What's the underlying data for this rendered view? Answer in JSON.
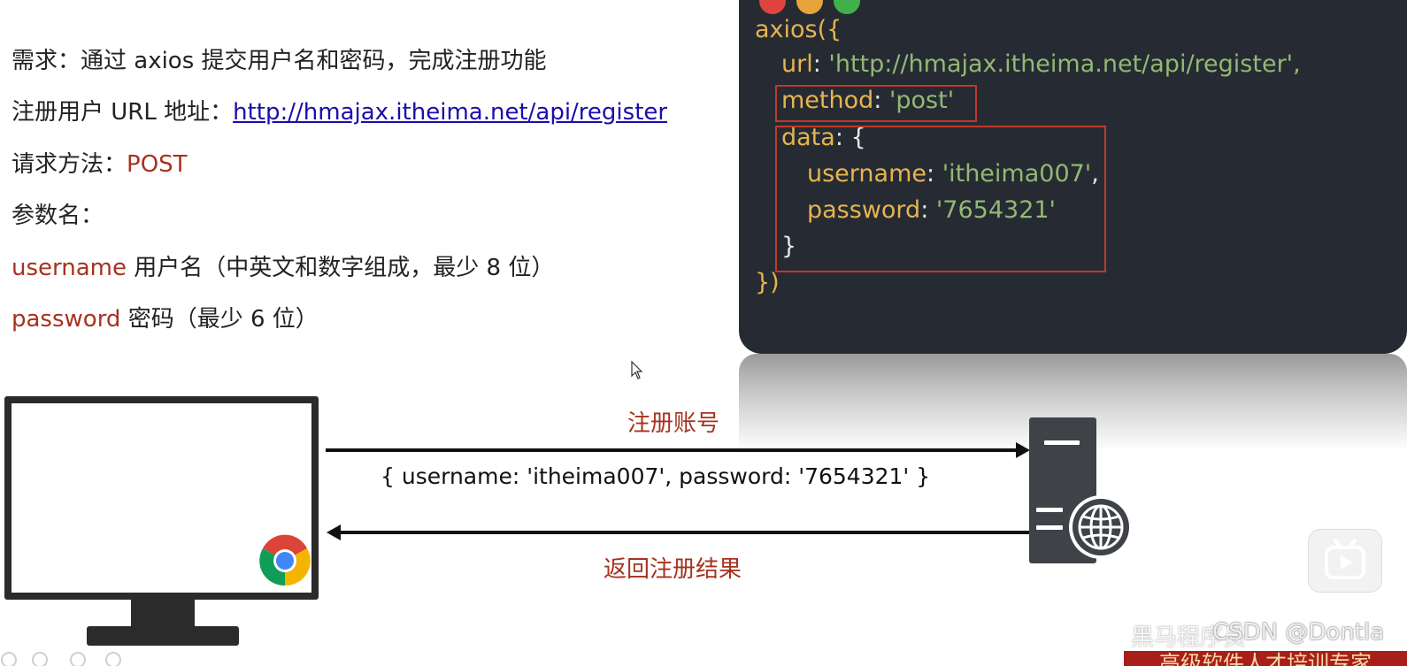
{
  "requirements": {
    "line1": "需求：通过 axios 提交用户名和密码，完成注册功能",
    "line2_prefix": "注册用户 URL 地址：",
    "line2_link": "http://hmajax.itheima.net/api/register",
    "line3_prefix": "请求方法：",
    "line3_method": "POST",
    "line4": "参数名：",
    "line5_param": "username",
    "line5_desc": " 用户名（中英文和数字组成，最少 8 位）",
    "line6_param": "password",
    "line6_desc": " 密码（最少 6 位）"
  },
  "code": {
    "line1": "axios({",
    "url_key": "url",
    "url_value": "'http://hmajax.itheima.net/api/register',",
    "method_key": "method",
    "method_value": "'post'",
    "data_key": "data",
    "data_open": ": {",
    "username_key": "username",
    "username_value": "'itheima007'",
    "password_key": "password",
    "password_value": "'7654321'",
    "inner_close": "}",
    "outer_close": "})",
    "colon": ": ",
    "comma": ","
  },
  "diagram": {
    "request_label": "注册账号",
    "payload": "{ username: 'itheima007', password: '7654321' }",
    "response_label": "返回注册结果"
  },
  "overlay": {
    "watermark": "CSDN @Dontla",
    "faded_text": "黑马程序员",
    "bottom_banner": "高级软件人才培训专家"
  },
  "icons": {
    "browser": "chrome-icon",
    "server": "server-icon",
    "globe": "globe-icon",
    "cursor": "cursor-icon",
    "play": "play-icon"
  },
  "colors": {
    "accent_red": "#a7321f",
    "code_bg": "#262b33",
    "code_key": "#e6b450",
    "code_string": "#93b873",
    "highlight_box": "#c0392b",
    "link": "#1a0dab"
  }
}
